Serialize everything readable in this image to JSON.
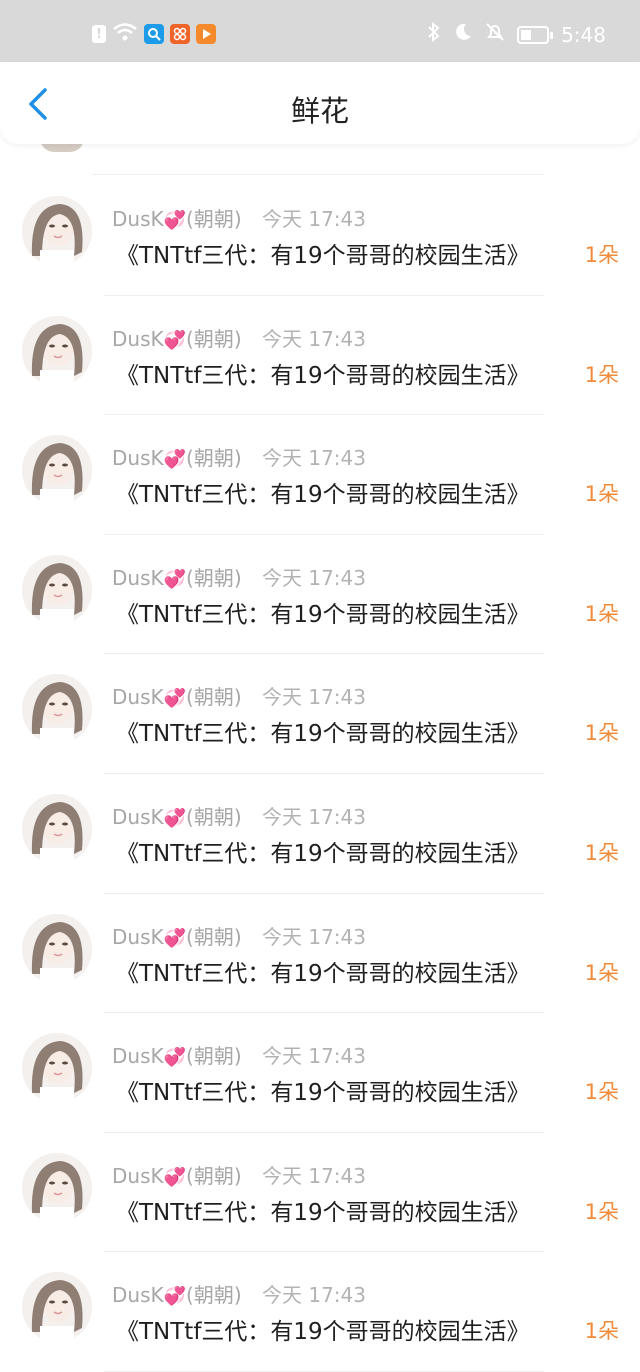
{
  "status_bar": {
    "time": "5:48",
    "left_icons": [
      "alert-icon",
      "wifi-icon",
      "search-app-icon",
      "app-icon-orange",
      "video-app-icon"
    ],
    "right_icons": [
      "bluetooth-icon",
      "moon-icon",
      "mute-icon",
      "battery-icon"
    ]
  },
  "header": {
    "title": "鲜花"
  },
  "colors": {
    "accent_blue": "#1e8fe3",
    "count_orange": "#f08b3a",
    "status_bar_bg": "#d9d9d9"
  },
  "items": [
    {
      "user": "DusK",
      "user_suffix": "(朝朝)",
      "time": "今天 17:43",
      "novel": "《TNTtf三代：有19个哥哥的校园生活》",
      "count": "1朵"
    },
    {
      "user": "DusK",
      "user_suffix": "(朝朝)",
      "time": "今天 17:43",
      "novel": "《TNTtf三代：有19个哥哥的校园生活》",
      "count": "1朵"
    },
    {
      "user": "DusK",
      "user_suffix": "(朝朝)",
      "time": "今天 17:43",
      "novel": "《TNTtf三代：有19个哥哥的校园生活》",
      "count": "1朵"
    },
    {
      "user": "DusK",
      "user_suffix": "(朝朝)",
      "time": "今天 17:43",
      "novel": "《TNTtf三代：有19个哥哥的校园生活》",
      "count": "1朵"
    },
    {
      "user": "DusK",
      "user_suffix": "(朝朝)",
      "time": "今天 17:43",
      "novel": "《TNTtf三代：有19个哥哥的校园生活》",
      "count": "1朵"
    },
    {
      "user": "DusK",
      "user_suffix": "(朝朝)",
      "time": "今天 17:43",
      "novel": "《TNTtf三代：有19个哥哥的校园生活》",
      "count": "1朵"
    },
    {
      "user": "DusK",
      "user_suffix": "(朝朝)",
      "time": "今天 17:43",
      "novel": "《TNTtf三代：有19个哥哥的校园生活》",
      "count": "1朵"
    },
    {
      "user": "DusK",
      "user_suffix": "(朝朝)",
      "time": "今天 17:43",
      "novel": "《TNTtf三代：有19个哥哥的校园生活》",
      "count": "1朵"
    },
    {
      "user": "DusK",
      "user_suffix": "(朝朝)",
      "time": "今天 17:43",
      "novel": "《TNTtf三代：有19个哥哥的校园生活》",
      "count": "1朵"
    },
    {
      "user": "DusK",
      "user_suffix": "(朝朝)",
      "time": "今天 17:43",
      "novel": "《TNTtf三代：有19个哥哥的校园生活》",
      "count": "1朵"
    }
  ]
}
